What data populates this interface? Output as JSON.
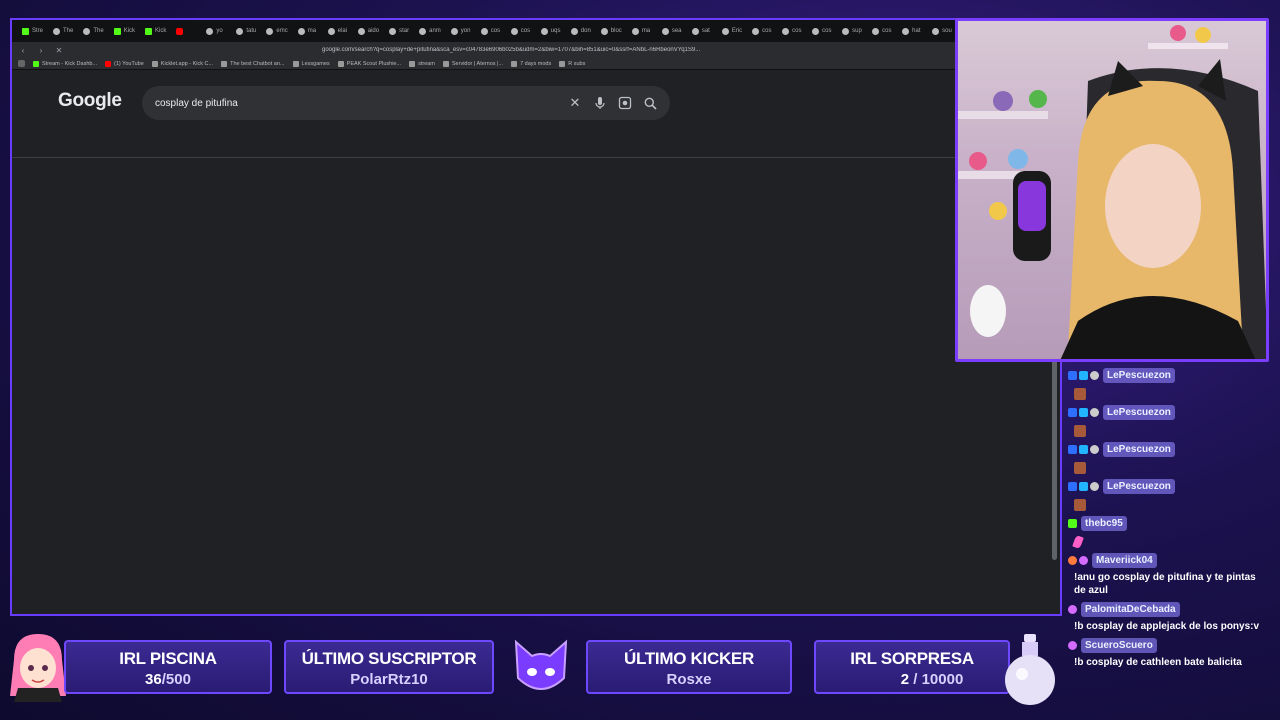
{
  "browser": {
    "tabs": [
      {
        "label": "Stre",
        "icon": "kick-favicon"
      },
      {
        "label": "The",
        "icon": "globe-favicon"
      },
      {
        "label": "The",
        "icon": "globe-favicon"
      },
      {
        "label": "Kick",
        "icon": "kick-favicon"
      },
      {
        "label": "Kick",
        "icon": "kick-favicon"
      },
      {
        "label": "",
        "icon": "youtube-favicon"
      },
      {
        "label": "yo",
        "icon": "globe-favicon"
      },
      {
        "label": "tatu",
        "icon": "globe-favicon"
      },
      {
        "label": "emc",
        "icon": "globe-favicon"
      },
      {
        "label": "ma",
        "icon": "globe-favicon"
      },
      {
        "label": "elai",
        "icon": "globe-favicon"
      },
      {
        "label": "aido",
        "icon": "globe-favicon"
      },
      {
        "label": "star",
        "icon": "globe-favicon"
      },
      {
        "label": "anm",
        "icon": "globe-favicon"
      },
      {
        "label": "yon",
        "icon": "globe-favicon"
      },
      {
        "label": "cos",
        "icon": "globe-favicon"
      },
      {
        "label": "cos",
        "icon": "globe-favicon"
      },
      {
        "label": "uqs",
        "icon": "globe-favicon"
      },
      {
        "label": "don",
        "icon": "globe-favicon"
      },
      {
        "label": "bloc",
        "icon": "globe-favicon"
      },
      {
        "label": "ma",
        "icon": "globe-favicon"
      },
      {
        "label": "sea",
        "icon": "globe-favicon"
      },
      {
        "label": "sat",
        "icon": "globe-favicon"
      },
      {
        "label": "Eric",
        "icon": "globe-favicon"
      },
      {
        "label": "cos",
        "icon": "globe-favicon"
      },
      {
        "label": "cos",
        "icon": "globe-favicon"
      },
      {
        "label": "cos",
        "icon": "globe-favicon"
      },
      {
        "label": "sup",
        "icon": "globe-favicon"
      },
      {
        "label": "cos",
        "icon": "globe-favicon"
      },
      {
        "label": "hat",
        "icon": "globe-favicon"
      },
      {
        "label": "sou",
        "icon": "globe-favicon"
      },
      {
        "label": "yon",
        "icon": "globe-favicon"
      }
    ],
    "url": "google.com/search?q=cosplay+de+pitufina&sca_esv=c04783e6906b025b&udm=2&biw=1707&bih=851&uic=0&ssrf=ANbL-n6RbeonVYq1S9...",
    "bookmarks": [
      {
        "label": "Stream - Kick Dashb...",
        "icon": "kick"
      },
      {
        "label": "(1) YouTube",
        "icon": "yt"
      },
      {
        "label": "Kicklet.app - Kick C...",
        "icon": "globe"
      },
      {
        "label": "The best Chatbot an...",
        "icon": "globe"
      },
      {
        "label": "Lessgames",
        "icon": "globe"
      },
      {
        "label": "PEAK Scout Plushie...",
        "icon": "globe"
      },
      {
        "label": "stream",
        "icon": "folder"
      },
      {
        "label": "Servidor | Aternos |...",
        "icon": "globe"
      },
      {
        "label": "7 days mods",
        "icon": "folder"
      },
      {
        "label": "R subs",
        "icon": "folder"
      }
    ],
    "google": {
      "logo": "Google",
      "query": "cosplay de pitufina"
    }
  },
  "chat": [
    {
      "user": "LePescuezon",
      "badges": [
        "b1",
        "b2",
        "b3"
      ],
      "emote": "brown"
    },
    {
      "user": "LePescuezon",
      "badges": [
        "b1",
        "b2",
        "b3"
      ],
      "emote": "brown"
    },
    {
      "user": "LePescuezon",
      "badges": [
        "b1",
        "b2",
        "b3"
      ],
      "emote": "brown"
    },
    {
      "user": "LePescuezon",
      "badges": [
        "b1",
        "b2",
        "b3"
      ],
      "emote": "brown"
    },
    {
      "user": "thebc95",
      "badges": [
        "g"
      ],
      "emote": "pink"
    },
    {
      "user": "Maveriick04",
      "badges": [
        "m",
        "p"
      ],
      "message": "!anu go cosplay de pitufina y te pintas de azul"
    },
    {
      "user": "PalomitaDeCebada",
      "badges": [
        "p"
      ],
      "message": "!b cosplay de applejack de los ponys:v"
    },
    {
      "user": "ScueroScuero",
      "badges": [
        "p"
      ],
      "message": "!b cosplay de cathleen bate balicita"
    }
  ],
  "panels": {
    "irl_piscina": {
      "title": "IRL PISCINA",
      "current": "36",
      "goal": "/500"
    },
    "ultimo_suscriptor": {
      "title": "ÚLTIMO SUSCRIPTOR",
      "value": "PolarRtz10"
    },
    "ultimo_kicker": {
      "title": "ÚLTIMO KICKER",
      "value": "Rosxe"
    },
    "irl_sorpresa": {
      "title": "IRL SORPRESA",
      "current": "2",
      "goal": "/ 10000"
    }
  },
  "colors": {
    "accent": "#6d48ff",
    "kick_green": "#53fc18",
    "chat_name_bg": "#786edc"
  }
}
